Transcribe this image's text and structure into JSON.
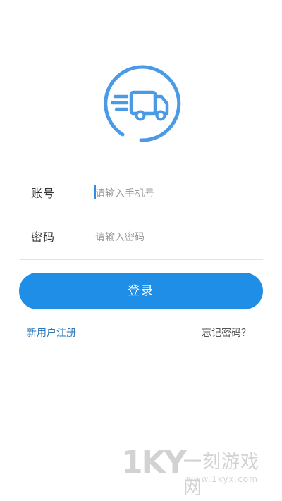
{
  "logo": {
    "icon": "delivery-truck-icon",
    "color": "#4a9ae6"
  },
  "form": {
    "account": {
      "label": "账号",
      "placeholder": "请输入手机号",
      "value": ""
    },
    "password": {
      "label": "密码",
      "placeholder": "请输入密码",
      "value": ""
    }
  },
  "actions": {
    "login_label": "登录",
    "register_label": "新用户注册",
    "forgot_label": "忘记密码？"
  },
  "watermark": {
    "logo_text": "1KY",
    "name": "一刻游戏网",
    "url": "www.1kyx.com"
  },
  "colors": {
    "primary": "#1e8ee6",
    "link": "#2a76b8"
  }
}
